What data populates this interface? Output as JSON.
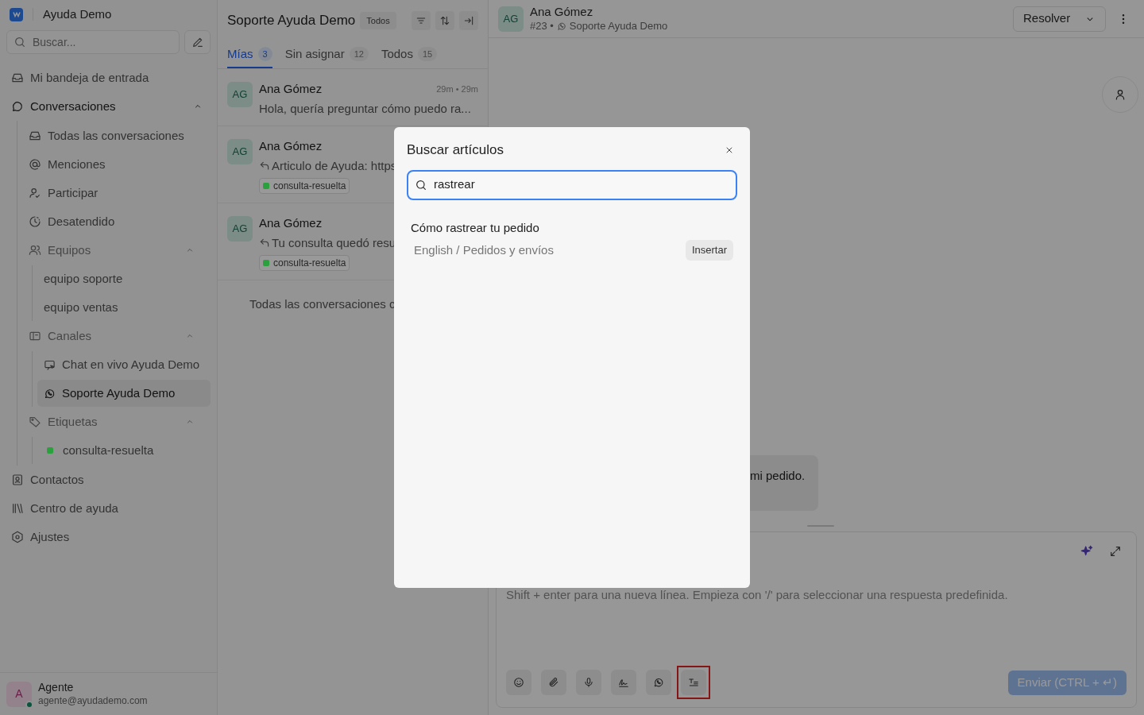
{
  "app": {
    "name": "Ayuda Demo"
  },
  "sidebar": {
    "search": {
      "placeholder": "Buscar..."
    },
    "items": [
      {
        "kind": "nav",
        "label": "Mi bandeja de entrada",
        "selected": false
      },
      {
        "kind": "group",
        "label": "Conversaciones",
        "expanded": true,
        "children": [
          {
            "kind": "sub",
            "label": "Todas las conversaciones",
            "selected": false
          },
          {
            "kind": "sub",
            "label": "Menciones",
            "selected": false
          },
          {
            "kind": "sub",
            "label": "Participar",
            "selected": false
          },
          {
            "kind": "sub",
            "label": "Desatendido",
            "selected": false
          },
          {
            "kind": "subgroup",
            "label": "Equipos",
            "expanded": true,
            "children": [
              {
                "kind": "team",
                "label": "equipo soporte",
                "selected": false
              },
              {
                "kind": "team",
                "label": "equipo ventas",
                "selected": false
              }
            ]
          },
          {
            "kind": "subgroup",
            "label": "Canales",
            "expanded": true,
            "children": [
              {
                "kind": "channel",
                "label": "Chat en vivo Ayuda Demo",
                "selected": false
              },
              {
                "kind": "channel",
                "label": "Soporte Ayuda Demo",
                "selected": true
              }
            ]
          },
          {
            "kind": "subgroup",
            "label": "Etiquetas",
            "expanded": true,
            "children": [
              {
                "kind": "label",
                "label": "consulta-resuelta",
                "color": "#2aa13c",
                "selected": false
              }
            ]
          }
        ]
      },
      {
        "kind": "nav",
        "label": "Contactos",
        "selected": false
      },
      {
        "kind": "nav",
        "label": "Centro de ayuda",
        "selected": false
      },
      {
        "kind": "nav",
        "label": "Ajustes",
        "selected": false
      }
    ],
    "user": {
      "initial": "A",
      "name": "Agente",
      "email": "agente@ayudademo.com",
      "online": true
    }
  },
  "list": {
    "title": "Soporte Ayuda Demo",
    "filter": "Todos",
    "tabs": [
      {
        "label": "Mías",
        "count": "3",
        "selected": true
      },
      {
        "label": "Sin asignar",
        "count": "12",
        "selected": false
      },
      {
        "label": "Todos",
        "count": "15",
        "selected": false
      }
    ],
    "conversations": [
      {
        "initials": "AG",
        "name": "Ana Gómez",
        "time": "29m • 29m",
        "reply": false,
        "preview": "Hola, quería preguntar cómo puedo ra..."
      },
      {
        "initials": "AG",
        "name": "Ana Gómez",
        "reply": true,
        "preview": "Articulo de Ayuda: https",
        "label": {
          "text": "consulta-resuelta",
          "color": "#2aa13c"
        }
      },
      {
        "initials": "AG",
        "name": "Ana Gómez",
        "reply": true,
        "preview": "Tu consulta quedó resu",
        "label": {
          "text": "consulta-resuelta",
          "color": "#2aa13c"
        }
      }
    ],
    "footer": "Todas las conversaciones c"
  },
  "chat": {
    "initials": "AG",
    "name": "Ana Gómez",
    "number": "#23 •",
    "inbox": "Soporte Ayuda Demo",
    "resolve": "Resolver",
    "message": "mi pedido.",
    "composer": {
      "placeholder": "Shift + enter para una nueva línea. Empieza con '/' para seleccionar una respuesta predefinida.",
      "tools": [
        {
          "highlighted": false
        },
        {
          "highlighted": false
        },
        {
          "highlighted": false
        },
        {
          "highlighted": false
        },
        {
          "highlighted": false
        },
        {
          "highlighted": true
        }
      ],
      "send": {
        "label": "Enviar (CTRL + ↵)",
        "disabled": true
      }
    }
  },
  "modal": {
    "title": "Buscar artículos",
    "search": {
      "value": "rastrear"
    },
    "results": [
      {
        "title": "Cómo rastrear tu pedido",
        "path": "English / Pedidos y envíos",
        "action": "Insertar"
      }
    ]
  }
}
